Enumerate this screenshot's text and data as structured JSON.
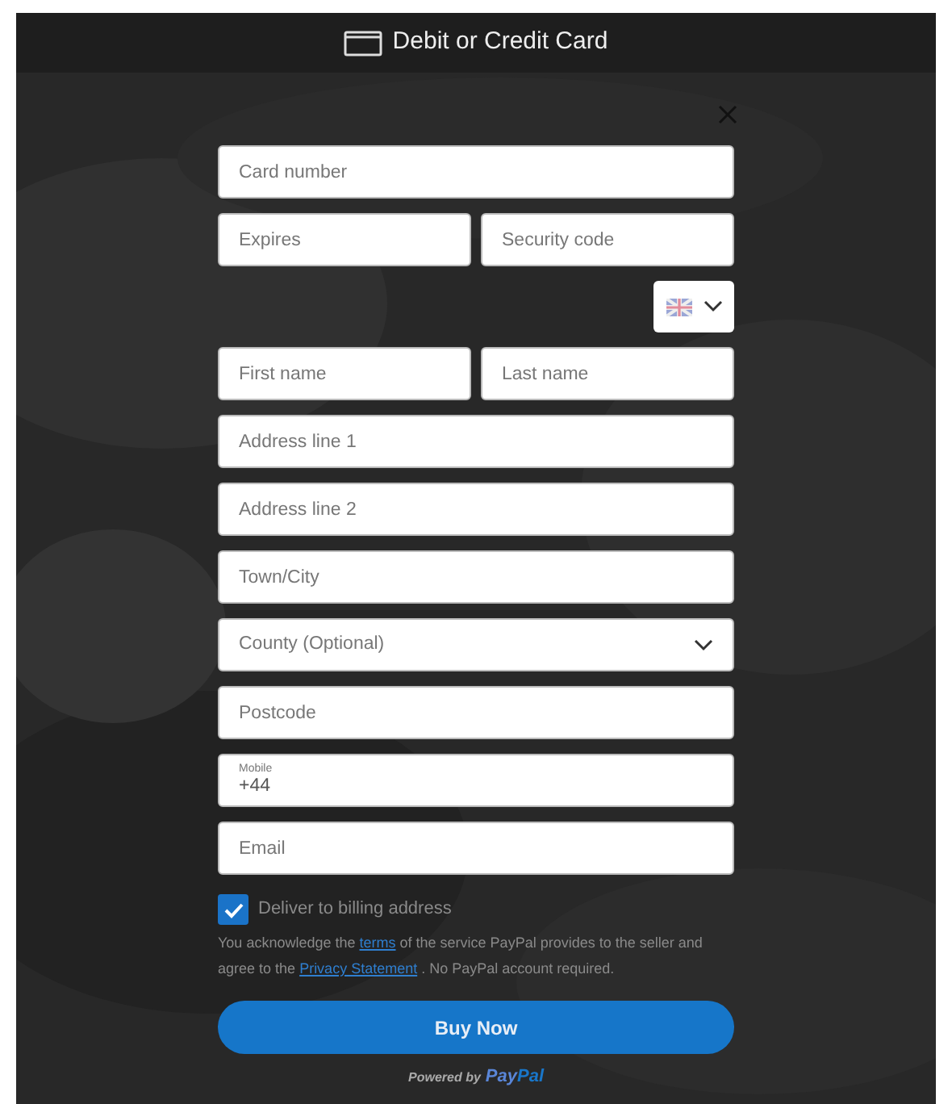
{
  "header": {
    "title": "Debit or Credit Card"
  },
  "rows": [
    {
      "kind": "input",
      "placeholder": "Card number"
    },
    {
      "kind": "pair",
      "fields": [
        {
          "placeholder": "Expires"
        },
        {
          "placeholder": "Security code"
        }
      ]
    },
    {
      "kind": "country"
    },
    {
      "kind": "pair",
      "fields": [
        {
          "placeholder": "First name"
        },
        {
          "placeholder": "Last name"
        }
      ]
    },
    {
      "kind": "input",
      "placeholder": "Address line 1"
    },
    {
      "kind": "input",
      "placeholder": "Address line 2"
    },
    {
      "kind": "input",
      "placeholder": "Town/City"
    },
    {
      "kind": "select",
      "text": "County (Optional)"
    },
    {
      "kind": "input",
      "placeholder": "Postcode"
    },
    {
      "kind": "labelled",
      "label": "Mobile",
      "value": "+44"
    },
    {
      "kind": "input",
      "placeholder": "Email"
    }
  ],
  "billing": {
    "label": "Deliver to billing address",
    "checked": true
  },
  "legal": [
    {
      "kind": "text",
      "text": "You acknowledge the"
    },
    {
      "kind": "link",
      "text": "terms"
    },
    {
      "kind": "text",
      "text": "of the service PayPal provides to the seller and agree to the"
    },
    {
      "kind": "link",
      "text": "Privacy Statement"
    },
    {
      "kind": "text",
      "text": ". No PayPal account required."
    }
  ],
  "submit": "Buy Now",
  "footer": {
    "powered": "Powered by",
    "brand": [
      "Pay",
      "Pal"
    ]
  }
}
